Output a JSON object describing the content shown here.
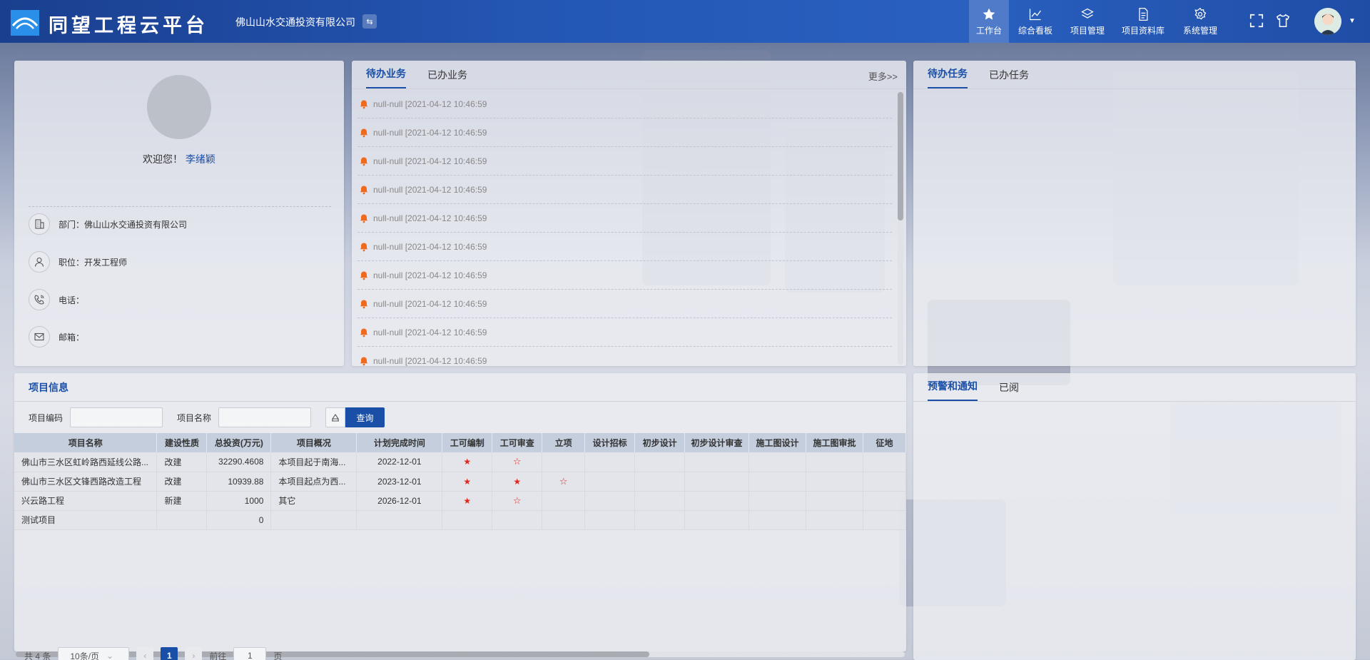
{
  "app": {
    "title": "同望工程云平台",
    "company": "佛山山水交通投资有限公司"
  },
  "nav": [
    {
      "label": "工作台",
      "icon": "star-icon",
      "active": true
    },
    {
      "label": "综合看板",
      "icon": "chart-line-icon"
    },
    {
      "label": "项目管理",
      "icon": "layers-icon"
    },
    {
      "label": "项目资料库",
      "icon": "document-icon"
    },
    {
      "label": "系统管理",
      "icon": "gear-icon"
    }
  ],
  "profile": {
    "welcome": "欢迎您！",
    "user_name": "李绪颖",
    "dept": "部门：佛山山水交通投资有限公司",
    "position": "职位：开发工程师",
    "phone": "电话：",
    "email": "邮箱："
  },
  "business": {
    "tabs": [
      "待办业务",
      "已办业务"
    ],
    "more": "更多>>",
    "items": [
      "null-null [2021-04-12 10:46:59",
      "null-null [2021-04-12 10:46:59",
      "null-null [2021-04-12 10:46:59",
      "null-null [2021-04-12 10:46:59",
      "null-null [2021-04-12 10:46:59",
      "null-null [2021-04-12 10:46:59",
      "null-null [2021-04-12 10:46:59",
      "null-null [2021-04-12 10:46:59",
      "null-null [2021-04-12 10:46:59",
      "null-null [2021-04-12 10:46:59"
    ]
  },
  "tasks": {
    "tabs": [
      "待办任务",
      "已办任务"
    ]
  },
  "project": {
    "title": "项目信息",
    "code_label": "项目编码",
    "name_label": "项目名称",
    "query_label": "查询",
    "columns": [
      "项目名称",
      "建设性质",
      "总投资(万元)",
      "项目概况",
      "计划完成时间",
      "工可编制",
      "工可审查",
      "立项",
      "设计招标",
      "初步设计",
      "初步设计审查",
      "施工图设计",
      "施工图审批",
      "征地"
    ],
    "rows": [
      [
        "佛山市三水区虹岭路西延线公路...",
        "改建",
        "32290.4608",
        "本项目起于南海...",
        "2022-12-01",
        "filled",
        "outline",
        "",
        "",
        "",
        "",
        "",
        "",
        ""
      ],
      [
        "佛山市三水区文锋西路改造工程",
        "改建",
        "10939.88",
        "本项目起点为西...",
        "2023-12-01",
        "filled",
        "filled",
        "outline",
        "",
        "",
        "",
        "",
        "",
        ""
      ],
      [
        "兴云路工程",
        "新建",
        "1000",
        "其它",
        "2026-12-01",
        "filled",
        "outline",
        "",
        "",
        "",
        "",
        "",
        "",
        ""
      ],
      [
        "测试项目",
        "",
        "0",
        "",
        "",
        "",
        "",
        "",
        "",
        "",
        "",
        "",
        "",
        ""
      ]
    ],
    "pager": {
      "total": "共 4 条",
      "page_size": "10条/页",
      "current": "1",
      "goto_label": "前往",
      "goto_value": "1",
      "page_unit": "页"
    }
  },
  "notices": {
    "tabs": [
      "预警和通知",
      "已阅"
    ]
  },
  "colors": {
    "primary": "#1a4fa8",
    "bell": "#f06a1d",
    "star": "#e0271c"
  }
}
